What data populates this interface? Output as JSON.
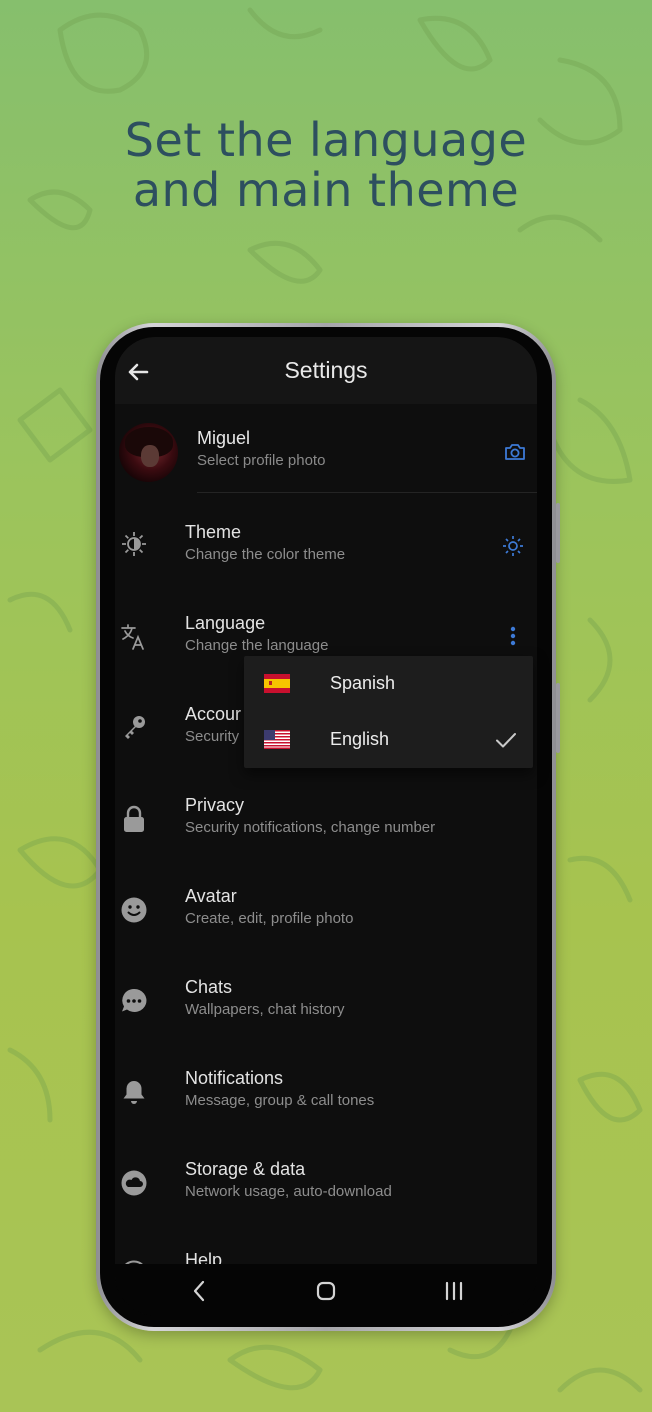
{
  "headline": {
    "line1": "Set the language",
    "line2": "and main theme"
  },
  "appbar": {
    "title": "Settings",
    "back_icon": "arrow-left-icon"
  },
  "profile": {
    "name": "Miguel",
    "subtitle": "Select profile photo",
    "action_icon": "camera-icon"
  },
  "rows": [
    {
      "id": "theme",
      "title": "Theme",
      "subtitle": "Change the color theme",
      "icon": "brightness-icon",
      "action_icon": "sun-icon"
    },
    {
      "id": "language",
      "title": "Language",
      "subtitle": "Change the language",
      "icon": "translate-icon",
      "action_icon": "more-vert-icon"
    },
    {
      "id": "account",
      "title": "Accour",
      "subtitle": "Security",
      "icon": "key-icon"
    },
    {
      "id": "privacy",
      "title": "Privacy",
      "subtitle": "Security notifications, change number",
      "icon": "lock-icon"
    },
    {
      "id": "avatar",
      "title": "Avatar",
      "subtitle": "Create, edit, profile photo",
      "icon": "smiley-icon"
    },
    {
      "id": "chats",
      "title": "Chats",
      "subtitle": "Wallpapers, chat history",
      "icon": "chat-bubble-icon"
    },
    {
      "id": "notifications",
      "title": "Notifications",
      "subtitle": "Message, group & call tones",
      "icon": "bell-icon"
    },
    {
      "id": "storage",
      "title": "Storage & data",
      "subtitle": "Network usage, auto-download",
      "icon": "cloud-icon"
    },
    {
      "id": "help",
      "title": "Help",
      "subtitle": "",
      "icon": "help-icon"
    }
  ],
  "language_menu": {
    "options": [
      {
        "label": "Spanish",
        "flag": "spain-flag-icon",
        "selected": false
      },
      {
        "label": "English",
        "flag": "us-flag-icon",
        "selected": true
      }
    ]
  },
  "navbar": {
    "back_icon": "nav-back-icon",
    "home_icon": "nav-home-icon",
    "recents_icon": "nav-recents-icon"
  },
  "colors": {
    "accent": "#3d7ad6",
    "headline": "#2d4f5f",
    "background_top": "#86bf6d",
    "background_bottom": "#a9c456"
  }
}
